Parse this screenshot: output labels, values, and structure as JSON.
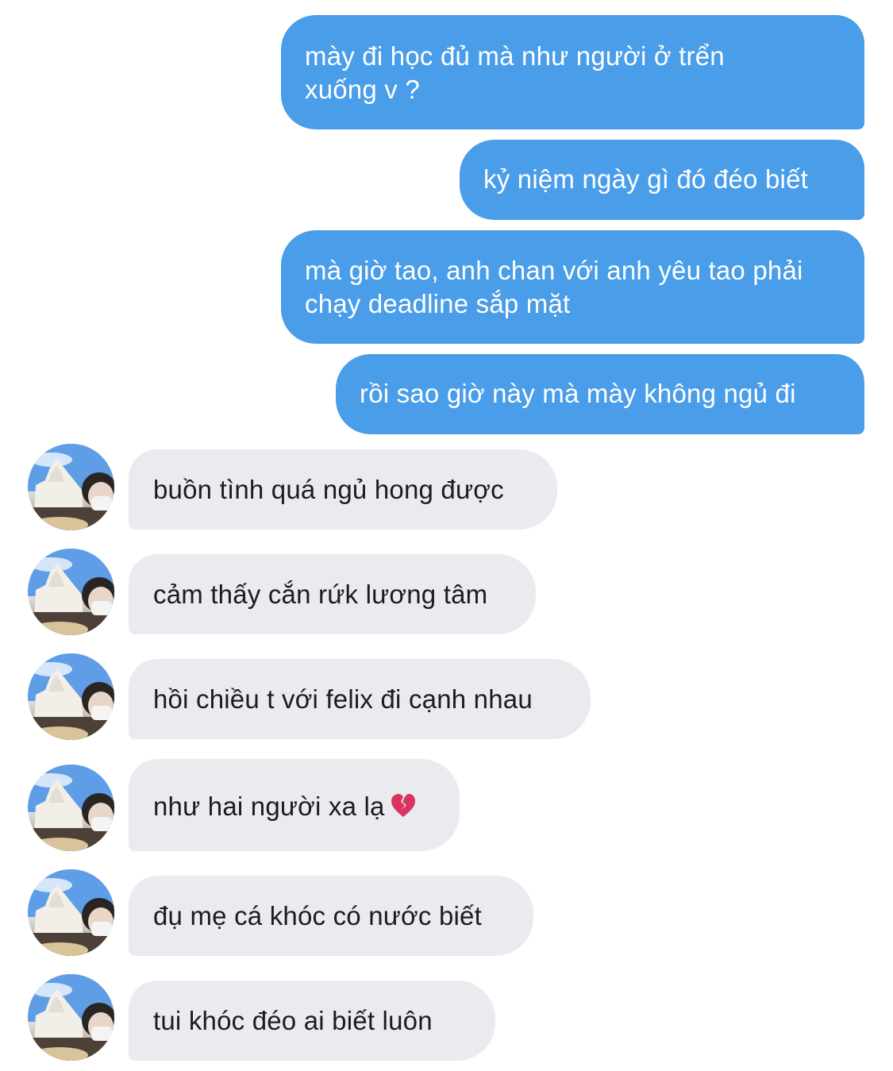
{
  "conversation": {
    "messages": [
      {
        "direction": "sent",
        "lines": [
          "mày đi học đủ mà như người ở trển",
          "xuống v ?"
        ]
      },
      {
        "direction": "sent",
        "lines": [
          "kỷ niệm ngày gì đó đéo biết"
        ]
      },
      {
        "direction": "sent",
        "lines": [
          "mà giờ tao, anh chan với anh yêu tao phải",
          "chạy deadline sắp mặt"
        ]
      },
      {
        "direction": "sent",
        "lines": [
          "rồi sao giờ này mà mày không ngủ đi"
        ]
      },
      {
        "direction": "received",
        "lines": [
          "buồn tình quá ngủ hong được"
        ]
      },
      {
        "direction": "received",
        "lines": [
          "cảm thấy cắn rứk lương tâm"
        ]
      },
      {
        "direction": "received",
        "lines": [
          "hồi chiều t với felix đi cạnh nhau"
        ]
      },
      {
        "direction": "received",
        "lines": [
          "như hai người xa lạ"
        ],
        "emoji": "broken-heart-icon"
      },
      {
        "direction": "received",
        "lines": [
          "đụ mẹ cá khóc có nước biết"
        ]
      },
      {
        "direction": "received",
        "lines": [
          "tui khóc đéo ai biết luôn"
        ]
      }
    ]
  },
  "colors": {
    "sent_bubble": "#4a9de8",
    "received_bubble": "#e9ebef",
    "sent_text": "#ffffff",
    "received_text": "#1c1c1e",
    "broken_heart": "#d8345f"
  }
}
